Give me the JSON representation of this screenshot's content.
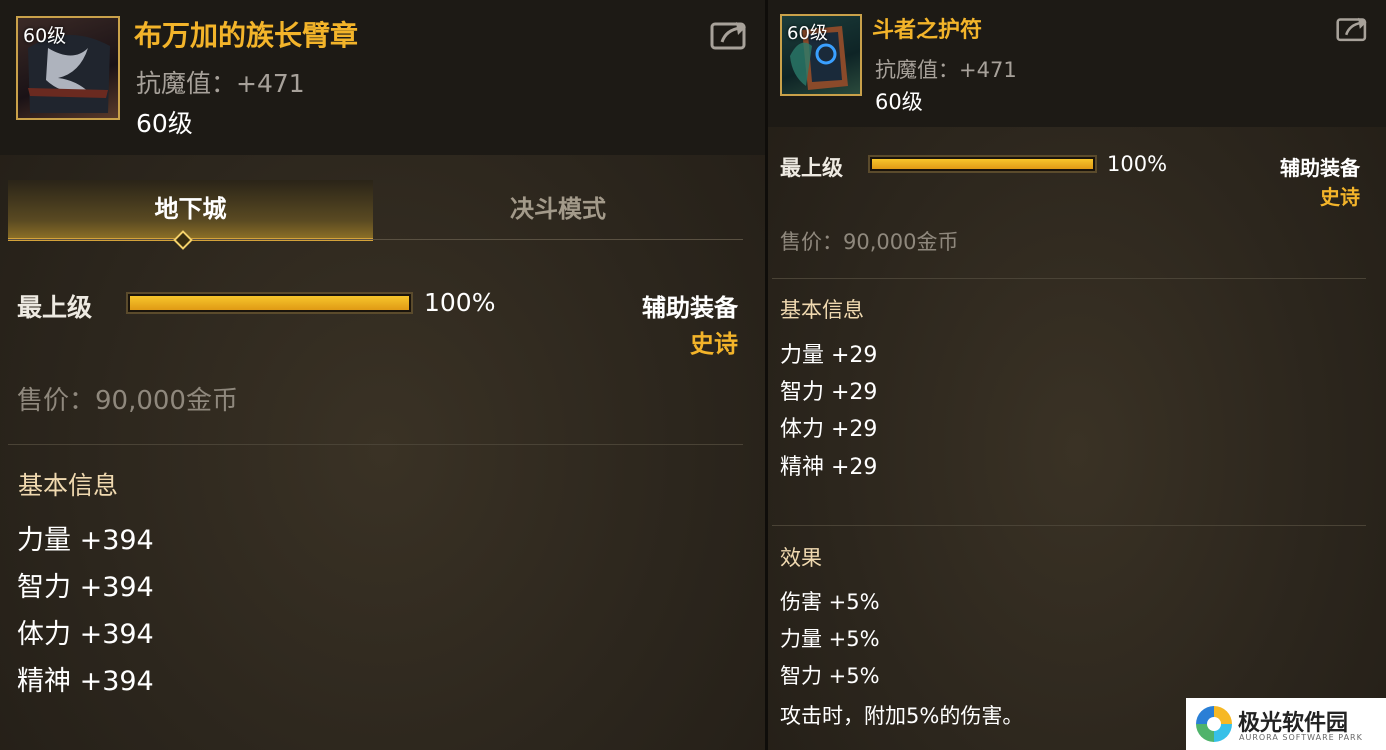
{
  "left": {
    "icon_level": "60级",
    "title": "布万加的族长臂章",
    "stat": "抗魔值：+471",
    "level": "60级",
    "tabs": [
      {
        "label": "地下城",
        "active": true
      },
      {
        "label": "决斗模式",
        "active": false
      }
    ],
    "grade_label": "最上级",
    "grade_progress": 1.0,
    "grade_pct": "100%",
    "equip_type": "辅助装备",
    "rarity": "史诗",
    "price": "售价：90,000金币",
    "basic_info_title": "基本信息",
    "basic_info": [
      "力量 +394",
      "智力 +394",
      "体力 +394",
      "精神 +394"
    ]
  },
  "right": {
    "icon_level": "60级",
    "title": "斗者之护符",
    "stat": "抗魔值：+471",
    "level": "60级",
    "grade_label": "最上级",
    "grade_progress": 1.0,
    "grade_pct": "100%",
    "equip_type": "辅助装备",
    "rarity": "史诗",
    "price": "售价：90,000金币",
    "basic_info_title": "基本信息",
    "basic_info": [
      "力量 +29",
      "智力 +29",
      "体力 +29",
      "精神 +29"
    ],
    "effect_title": "效果",
    "effects": [
      "伤害 +5%",
      "力量 +5%",
      "智力 +5%",
      "攻击时，附加5%的伤害。"
    ]
  },
  "watermark": {
    "name": "极光软件园",
    "sub": "AURORA SOFTWARE PARK"
  },
  "colors": {
    "title_gold": "#f3b42a",
    "bar_fill": "#f7c62c",
    "background": "#2c261d"
  },
  "icons": [
    "share-icon",
    "item-armband-icon",
    "item-amulet-icon",
    "tab-marker-icon"
  ]
}
